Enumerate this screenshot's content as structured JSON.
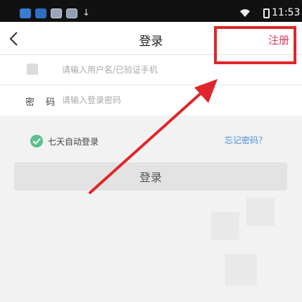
{
  "status_bar": {
    "time": "11:53",
    "icons": [
      "app-icon-1",
      "app-icon-2",
      "app-icon-3",
      "app-icon-4",
      "download-icon",
      "wifi-icon",
      "battery-icon"
    ]
  },
  "nav": {
    "title": "登录",
    "register_label": "注册"
  },
  "form": {
    "username": {
      "placeholder": "请输入用户名/已验证手机",
      "value": ""
    },
    "password": {
      "label": "密 码",
      "placeholder": "请输入登录密码",
      "value": ""
    }
  },
  "options": {
    "auto_login_label": "七天自动登录",
    "auto_login_checked": true,
    "forgot_label": "忘记密码？"
  },
  "login_button": {
    "label": "登录"
  },
  "colors": {
    "accent_register": "#d8395f",
    "check_green": "#5cc08d",
    "link_blue": "#4a8fd6",
    "annotation_red": "#e0262a"
  }
}
